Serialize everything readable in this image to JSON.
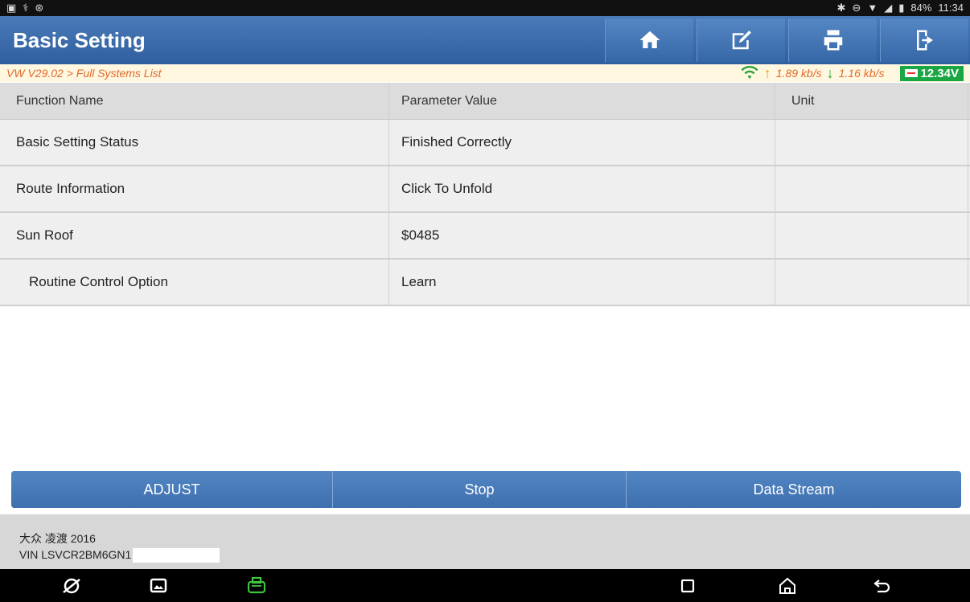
{
  "statusbar": {
    "left_icons": [
      "image-icon",
      "usb-debug-icon",
      "accessibility-icon"
    ],
    "right_icons": [
      "bluetooth-icon",
      "dnd-icon",
      "wifi-signal-icon",
      "cell-signal-icon",
      "battery-icon"
    ],
    "battery": "84%",
    "time": "11:34"
  },
  "appbar": {
    "title": "Basic Setting",
    "buttons": [
      "home-icon",
      "edit-report-icon",
      "print-icon",
      "exit-icon"
    ]
  },
  "crumbbar": {
    "breadcrumb": "VW V29.02 > Full Systems List",
    "upload_speed": "1.89 kb/s",
    "download_speed": "1.16 kb/s",
    "voltage": "12.34V"
  },
  "table": {
    "headers": [
      "Function Name",
      "Parameter Value",
      "Unit"
    ],
    "rows": [
      {
        "name": "Basic Setting Status",
        "value": "Finished Correctly",
        "unit": ""
      },
      {
        "name": "Route Information",
        "value": "Click To Unfold",
        "unit": ""
      },
      {
        "name": "Sun Roof",
        "value": "$0485",
        "unit": ""
      },
      {
        "name": "Routine Control Option",
        "value": "Learn",
        "unit": ""
      }
    ]
  },
  "actions": {
    "adjust": "ADJUST",
    "stop": "Stop",
    "data_stream": "Data Stream"
  },
  "footer": {
    "vehicle": "大众 凌渡 2016",
    "vin": "VIN LSVCR2BM6GN1"
  },
  "colors": {
    "appbar": "#3a6aab",
    "accent_orange": "#e06a2a",
    "voltage_green": "#1aa642"
  }
}
